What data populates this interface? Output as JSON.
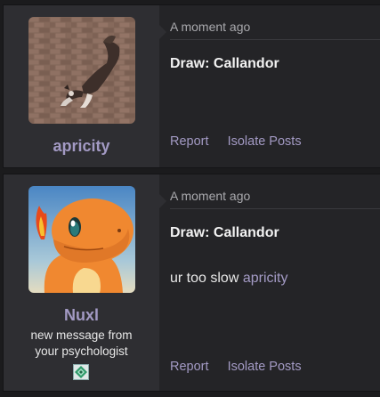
{
  "posts": [
    {
      "username": "apricity",
      "avatar_icon": "dog-photo-avatar",
      "timestamp": "A moment ago",
      "title": "Draw: Callandor",
      "actions": {
        "report": "Report",
        "isolate": "Isolate Posts"
      }
    },
    {
      "username": "Nuxl",
      "avatar_icon": "charmander-avatar",
      "user_title": [
        "new message from",
        "your psychologist"
      ],
      "badge_icon": "diamond-badge-icon",
      "timestamp": "A moment ago",
      "title": "Draw: Callandor",
      "message": {
        "text": "ur too slow ",
        "mention": "apricity"
      },
      "actions": {
        "report": "Report",
        "isolate": "Isolate Posts"
      }
    }
  ],
  "colors": {
    "accent": "#a39ac4",
    "background": "#1b1b1d",
    "post_bg": "#242427",
    "author_bg": "#2e2e32"
  }
}
